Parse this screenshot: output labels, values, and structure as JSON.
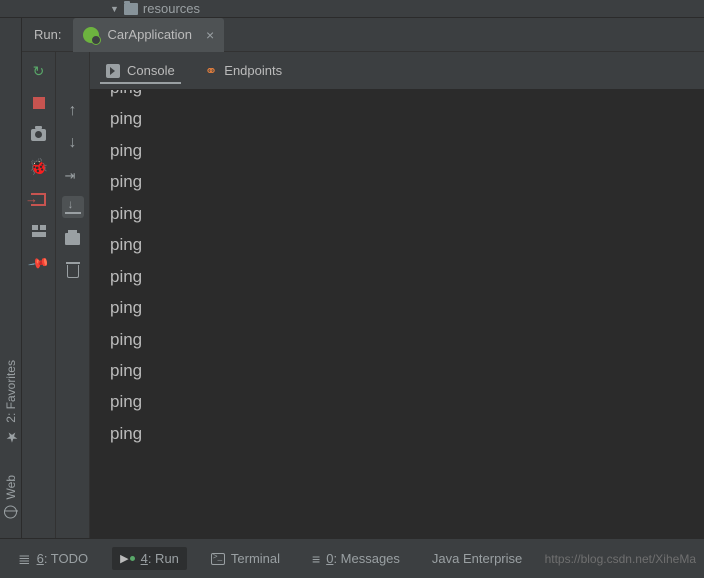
{
  "tree": {
    "item": "resources"
  },
  "run": {
    "label": "Run:",
    "tab": "CarApplication"
  },
  "console": {
    "tabs": {
      "console": "Console",
      "endpoints": "Endpoints"
    },
    "lines": [
      "ping",
      "ping",
      "ping",
      "ping",
      "ping",
      "ping",
      "ping",
      "ping",
      "ping",
      "ping",
      "ping",
      "ping"
    ]
  },
  "sidetabs": {
    "favorites": "2: Favorites",
    "web": "Web"
  },
  "bottom": {
    "todo": {
      "num": "6",
      "label": ": TODO"
    },
    "run": {
      "num": "4",
      "label": ": Run"
    },
    "terminal": "Terminal",
    "messages": {
      "num": "0",
      "label": ": Messages"
    },
    "enterprise": "Java Enterprise"
  },
  "watermark": "https://blog.csdn.net/XiheMa"
}
